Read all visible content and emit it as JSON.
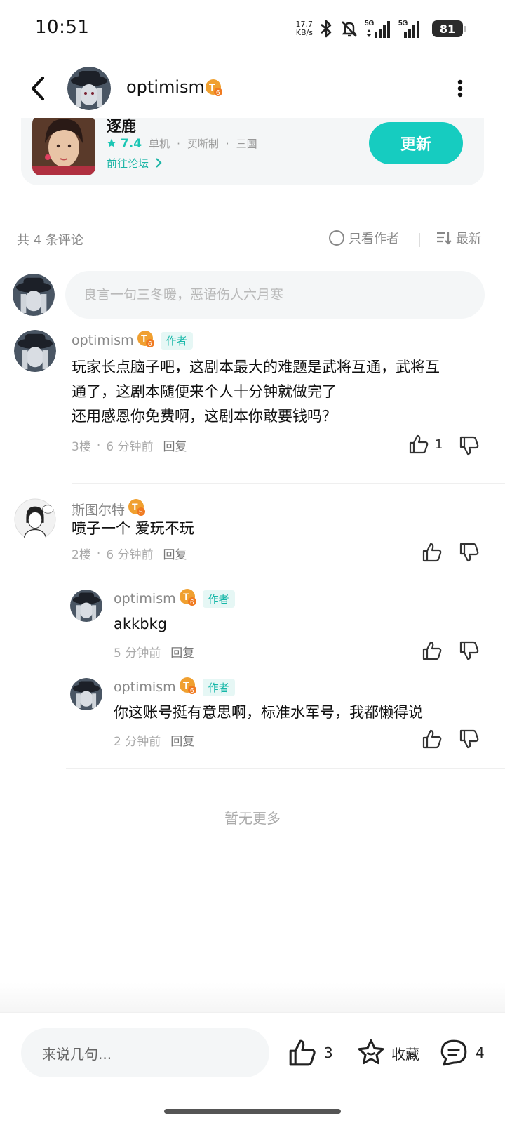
{
  "status_bar": {
    "time": "10:51",
    "net_speed_value": "17.7",
    "net_speed_unit": "KB/s",
    "signal_1_label": "5G",
    "signal_2_label": "5G",
    "battery": "81"
  },
  "header": {
    "user_name": "optimism",
    "level_badge": "T6"
  },
  "game_card": {
    "title": "逐鹿",
    "score": "7.4",
    "tags": [
      "单机",
      "买断制",
      "三国"
    ],
    "forum_link": "前往论坛",
    "update_label": "更新"
  },
  "comment_bar": {
    "count_text": "共 4 条评论",
    "author_only_label": "只看作者",
    "sort_label": "最新"
  },
  "compose": {
    "placeholder": "良言一句三冬暖，恶语伤人六月寒"
  },
  "comments": [
    {
      "user": "optimism",
      "level": "T6",
      "author_tag": "作者",
      "lines": [
        "玩家长点脑子吧，这剧本最大的难题是武将互通，武将互",
        "通了，这剧本随便来个人十分钟就做完了",
        "还用感恩你免费啊，这剧本你敢要钱吗？"
      ],
      "floor": "3楼",
      "time": "6 分钟前",
      "reply_label": "回复",
      "likes": "1"
    },
    {
      "user": "斯图尔特",
      "level": "T5",
      "lines": [
        "喷子一个 爱玩不玩"
      ],
      "floor": "2楼",
      "time": "6 分钟前",
      "reply_label": "回复",
      "replies": [
        {
          "user": "optimism",
          "level": "T6",
          "author_tag": "作者",
          "text": "akkbkg",
          "time": "5 分钟前",
          "reply_label": "回复"
        },
        {
          "user": "optimism",
          "level": "T6",
          "author_tag": "作者",
          "text": "你这账号挺有意思啊，标准水军号，我都懒得说",
          "time": "2 分钟前",
          "reply_label": "回复"
        }
      ]
    }
  ],
  "no_more_text": "暂无更多",
  "bottom_bar": {
    "say_placeholder": "来说几句...",
    "like_count": "3",
    "favorite_label": "收藏",
    "comment_count": "4"
  },
  "colors": {
    "accent": "#16ccc0",
    "badge_orange": "#f0a030"
  }
}
